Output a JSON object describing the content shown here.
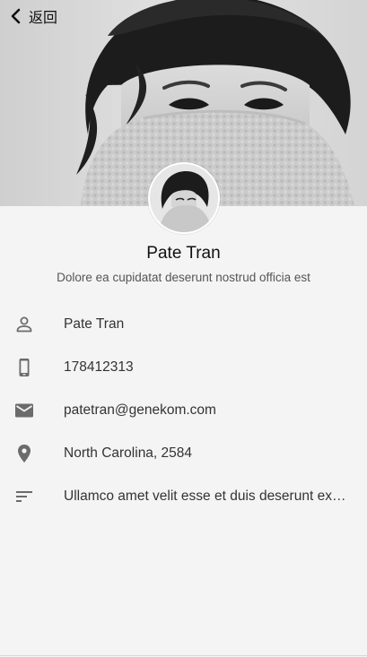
{
  "nav": {
    "back_label": "返回",
    "back_icon": "chevron-left-icon"
  },
  "profile": {
    "name": "Pate Tran",
    "bio": "Dolore ea cupidatat deserunt nostrud officia est"
  },
  "details": [
    {
      "icon": "person-icon",
      "text": "Pate Tran"
    },
    {
      "icon": "phone-icon",
      "text": "178412313"
    },
    {
      "icon": "email-icon",
      "text": "patetran@genekom.com"
    },
    {
      "icon": "location-pin-icon",
      "text": "North Carolina, 2584"
    },
    {
      "icon": "notes-icon",
      "text": "Ullamco amet velit esse et duis deserunt ex proident"
    }
  ],
  "colors": {
    "background": "#f4f4f4",
    "icon": "#6b6b6b",
    "text": "#333333"
  }
}
